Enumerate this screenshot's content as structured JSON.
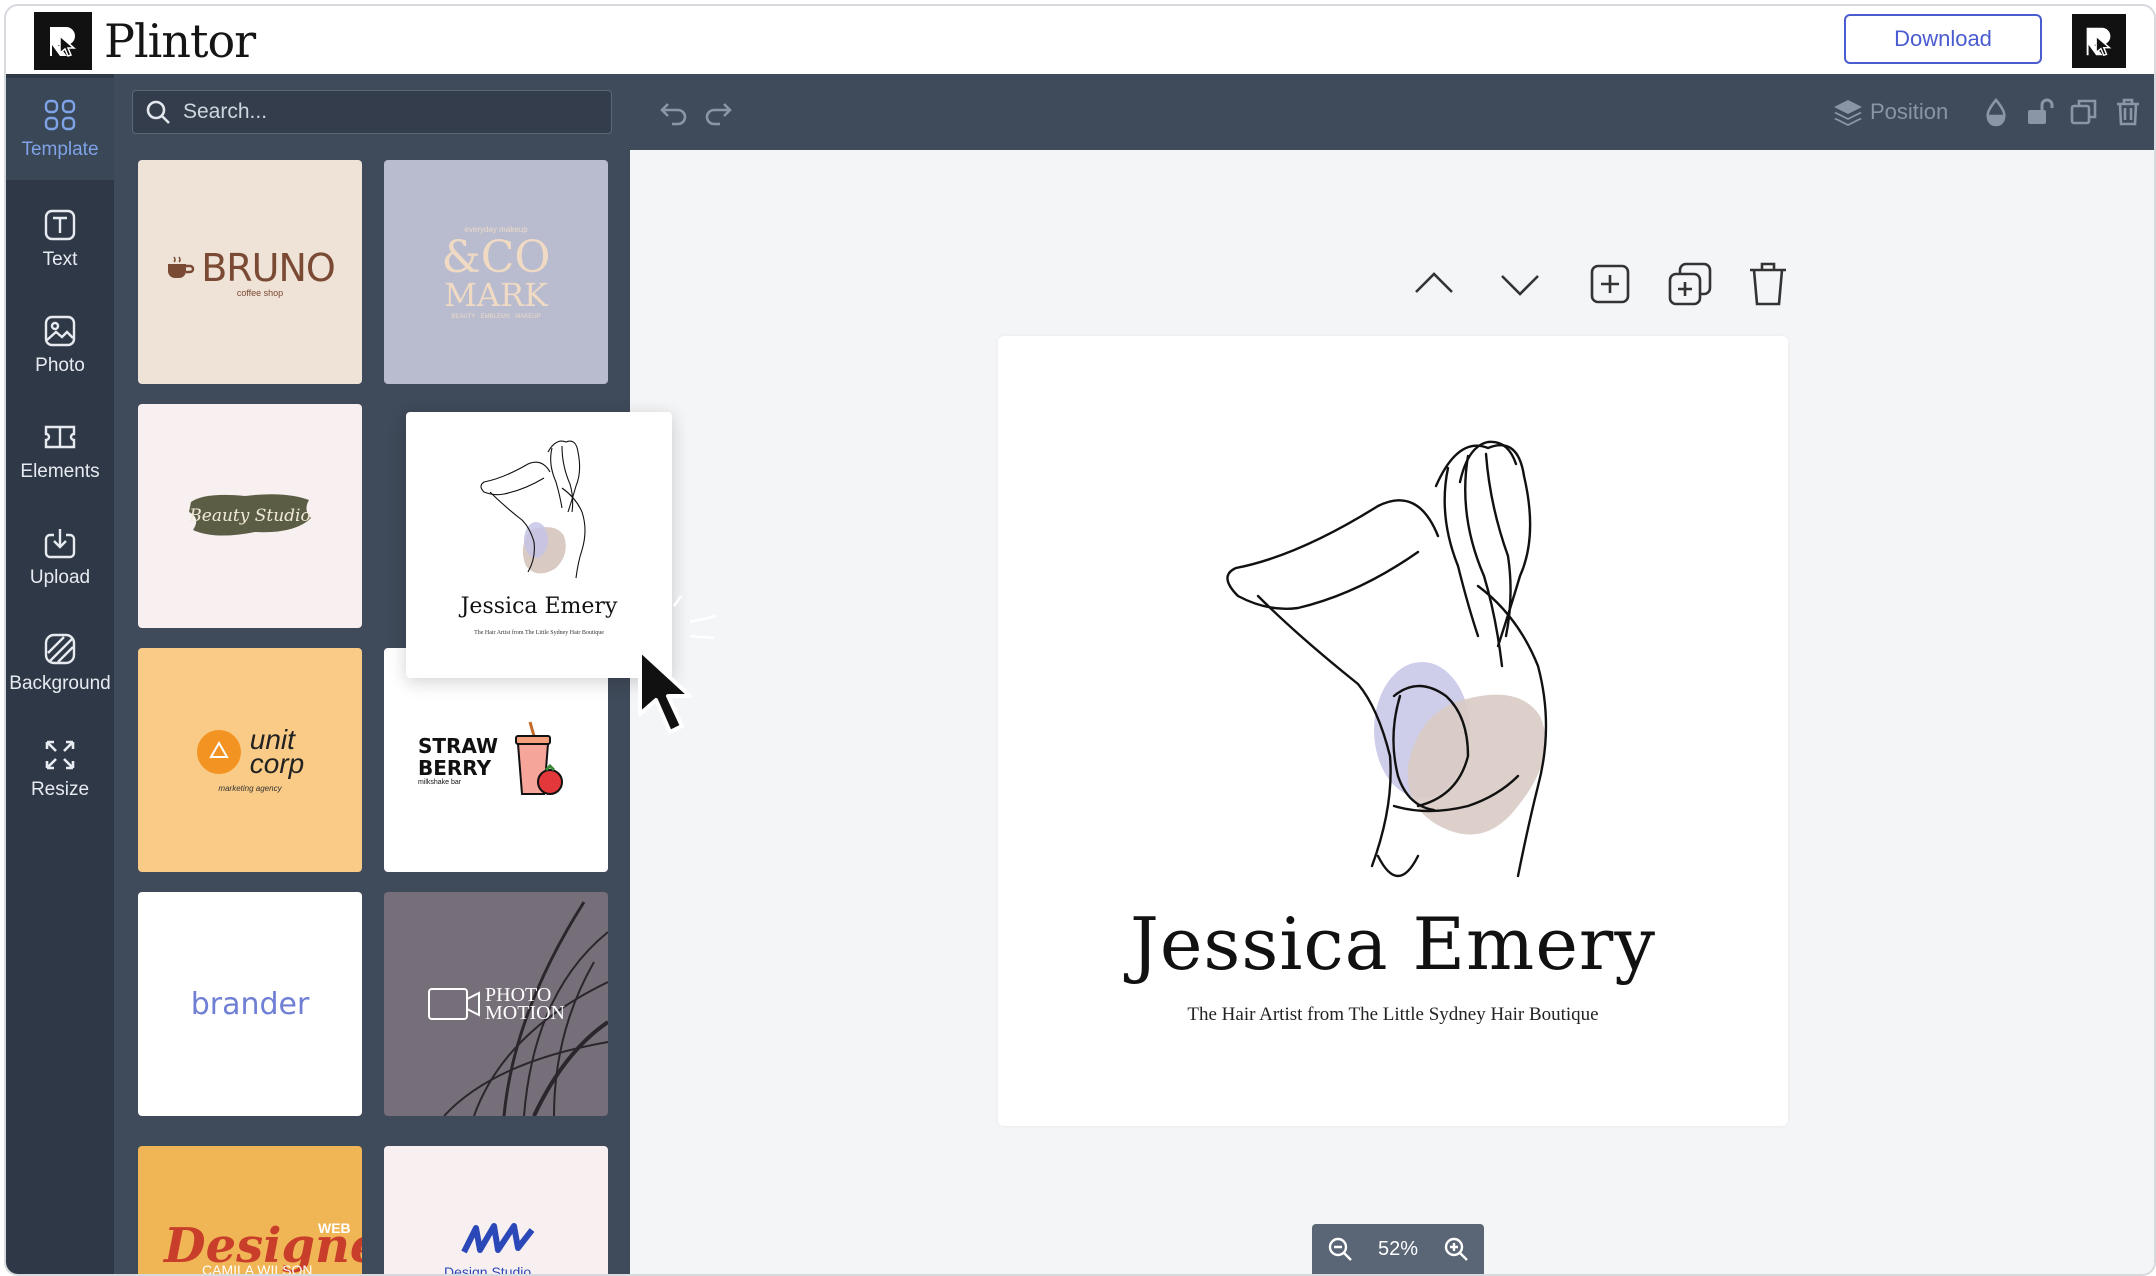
{
  "app": {
    "name": "Plintor",
    "download_label": "Download"
  },
  "rail": {
    "items": [
      {
        "label": "Template",
        "icon": "grid-icon",
        "active": true
      },
      {
        "label": "Text",
        "icon": "text-icon"
      },
      {
        "label": "Photo",
        "icon": "photo-icon"
      },
      {
        "label": "Elements",
        "icon": "elements-icon"
      },
      {
        "label": "Upload",
        "icon": "upload-icon"
      },
      {
        "label": "Background",
        "icon": "background-icon"
      },
      {
        "label": "Resize",
        "icon": "resize-icon"
      }
    ]
  },
  "panel": {
    "search_placeholder": "Search...",
    "templates": [
      {
        "id": "bruno",
        "title": "BRUNO",
        "subtitle": "coffee shop"
      },
      {
        "id": "coMark",
        "top": "everyday makeup",
        "title1": "&CO",
        "title2": "MARK",
        "subtitle": "BEAUTY · EMBLEMS · MAKEUP"
      },
      {
        "id": "beauty",
        "title": "Beauty Studio"
      },
      {
        "id": "unitcorp",
        "title1": "unit",
        "title2": "corp",
        "subtitle": "marketing agency"
      },
      {
        "id": "strawberry",
        "title1": "STRAW",
        "title2": "BERRY",
        "subtitle": "milkshake bar"
      },
      {
        "id": "brander",
        "title": "brander"
      },
      {
        "id": "photomotion",
        "title1": "PHOTO",
        "title2": "MOTION"
      },
      {
        "id": "designer",
        "tag": "WEB",
        "title": "Designer",
        "subtitle": "CAMILA WILSON"
      },
      {
        "id": "designstudio",
        "title": "Design Studio"
      }
    ]
  },
  "toolbar": {
    "position_label": "Position"
  },
  "canvas": {
    "name": "Jessica Emery",
    "tagline": "The Hair Artist from The Little Sydney Hair Boutique",
    "zoom": "52%"
  },
  "drag_preview": {
    "name": "Jessica Emery",
    "tagline": "The Hair Artist from The Little Sydney Hair Boutique"
  },
  "colors": {
    "accent": "#4a5ccf",
    "rail_bg": "#2f3846",
    "panel_bg": "#3f4a5a",
    "active_rail": "#7ea3e6"
  }
}
